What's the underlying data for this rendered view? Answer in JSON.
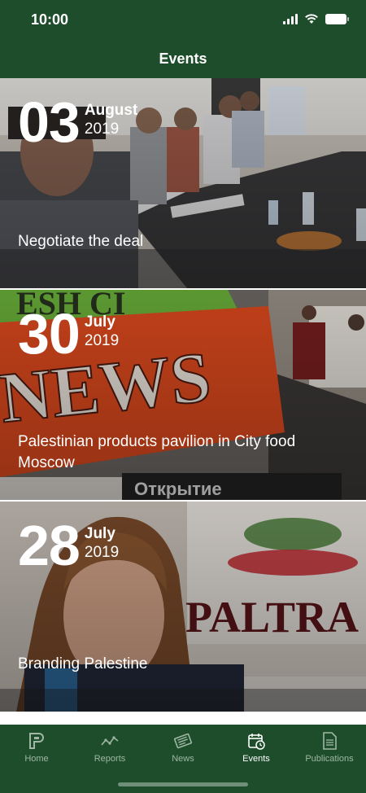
{
  "status_bar": {
    "time": "10:00"
  },
  "header": {
    "title": "Events"
  },
  "events": [
    {
      "day": "03",
      "month": "August",
      "year": "2019",
      "title": "Negotiate the deal"
    },
    {
      "day": "30",
      "month": "July",
      "year": "2019",
      "title": "Palestinian products pavilion in City food Moscow"
    },
    {
      "day": "28",
      "month": "July",
      "year": "2019",
      "title": "Branding Palestine"
    }
  ],
  "tabs": [
    {
      "label": "Home",
      "icon": "home-logo-icon",
      "active": false
    },
    {
      "label": "Reports",
      "icon": "chart-line-icon",
      "active": false
    },
    {
      "label": "News",
      "icon": "newspaper-icon",
      "active": false
    },
    {
      "label": "Events",
      "icon": "calendar-clock-icon",
      "active": true
    },
    {
      "label": "Publications",
      "icon": "document-icon",
      "active": false
    }
  ],
  "colors": {
    "primary": "#1e4d2b",
    "tab_inactive": "#9fb7a4",
    "tab_active": "#ffffff"
  }
}
